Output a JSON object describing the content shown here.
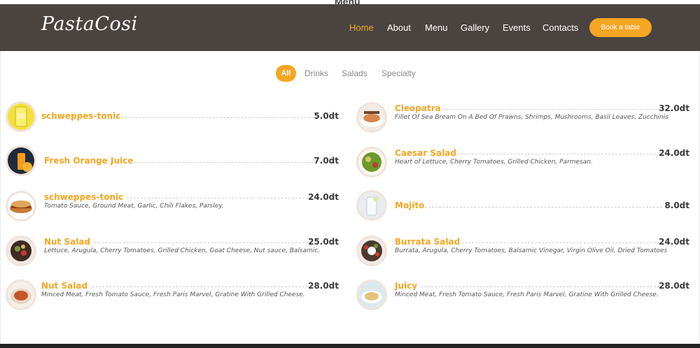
{
  "header": {
    "partial_title": "Menu",
    "logo": "PastaCosi",
    "nav": [
      "Home",
      "About",
      "Menu",
      "Gallery",
      "Events",
      "Contacts"
    ],
    "active_nav": "Home",
    "book_button": "Book a table"
  },
  "filters": {
    "items": [
      "All",
      "Drinks",
      "Salads",
      "Specialty"
    ],
    "active": "All"
  },
  "menu": {
    "left": [
      {
        "name": "schweppes-tonic",
        "price": "5.0dt",
        "description": "",
        "thumb": "tonic-can-icon"
      },
      {
        "name": "Fresh Orange Juice",
        "price": "7.0dt",
        "description": "",
        "thumb": "orange-juice-icon"
      },
      {
        "name": "schweppes-tonic",
        "price": "24.0dt",
        "description": "Tomato Sauce, Ground Meat, Garlic, Chili Flakes, Parsley.",
        "thumb": "sandwich-icon"
      },
      {
        "name": "Nut Salad",
        "price": "25.0dt",
        "description": "Lettuce, Arugula, Cherry Tomatoes, Grilled Chicken, Goat Cheese, Nut sauce, Balsamic.",
        "thumb": "nut-salad-icon"
      },
      {
        "name": "Nut Salad",
        "price": "28.0dt",
        "description": "Minced Meat, Fresh Tomato Sauce, Fresh Paris Marvel, Gratine With Grilled Cheese.",
        "thumb": "pasta-dish-icon"
      }
    ],
    "right": [
      {
        "name": "Cleopatra",
        "price": "32.0dt",
        "description": "Fillet Of Sea Bream On A Bed Of Prawns, Shrimps, Mushrooms, Basil Leaves, Zucchinis",
        "thumb": "cleopatra-dish-icon"
      },
      {
        "name": "Caesar Salad",
        "price": "24.0dt",
        "description": "Heart of Lettuce, Cherry Tomatoes, Grilled Chicken, Parmesan.",
        "thumb": "caesar-salad-icon"
      },
      {
        "name": "Mojito",
        "price": "8.0dt",
        "description": "",
        "thumb": "mojito-glass-icon"
      },
      {
        "name": "Burrata Salad",
        "price": "24.0dt",
        "description": "Burrata, Arugula, Cherry Tomatoes, Balsamic Vinegar, Virgin Olive Oil, Dried Tomatoes",
        "thumb": "burrata-salad-icon"
      },
      {
        "name": "Juicy",
        "price": "28.0dt",
        "description": "Minced Meat, Fresh Tomato Sauce, Fresh Paris Marvel, Gratine With Grilled Cheese.",
        "thumb": "juicy-dish-icon"
      }
    ]
  },
  "colors": {
    "accent": "#f6a623",
    "navbar": "#4a4441",
    "price_text": "#3b3b3b",
    "muted_text": "#8a8a8a"
  }
}
